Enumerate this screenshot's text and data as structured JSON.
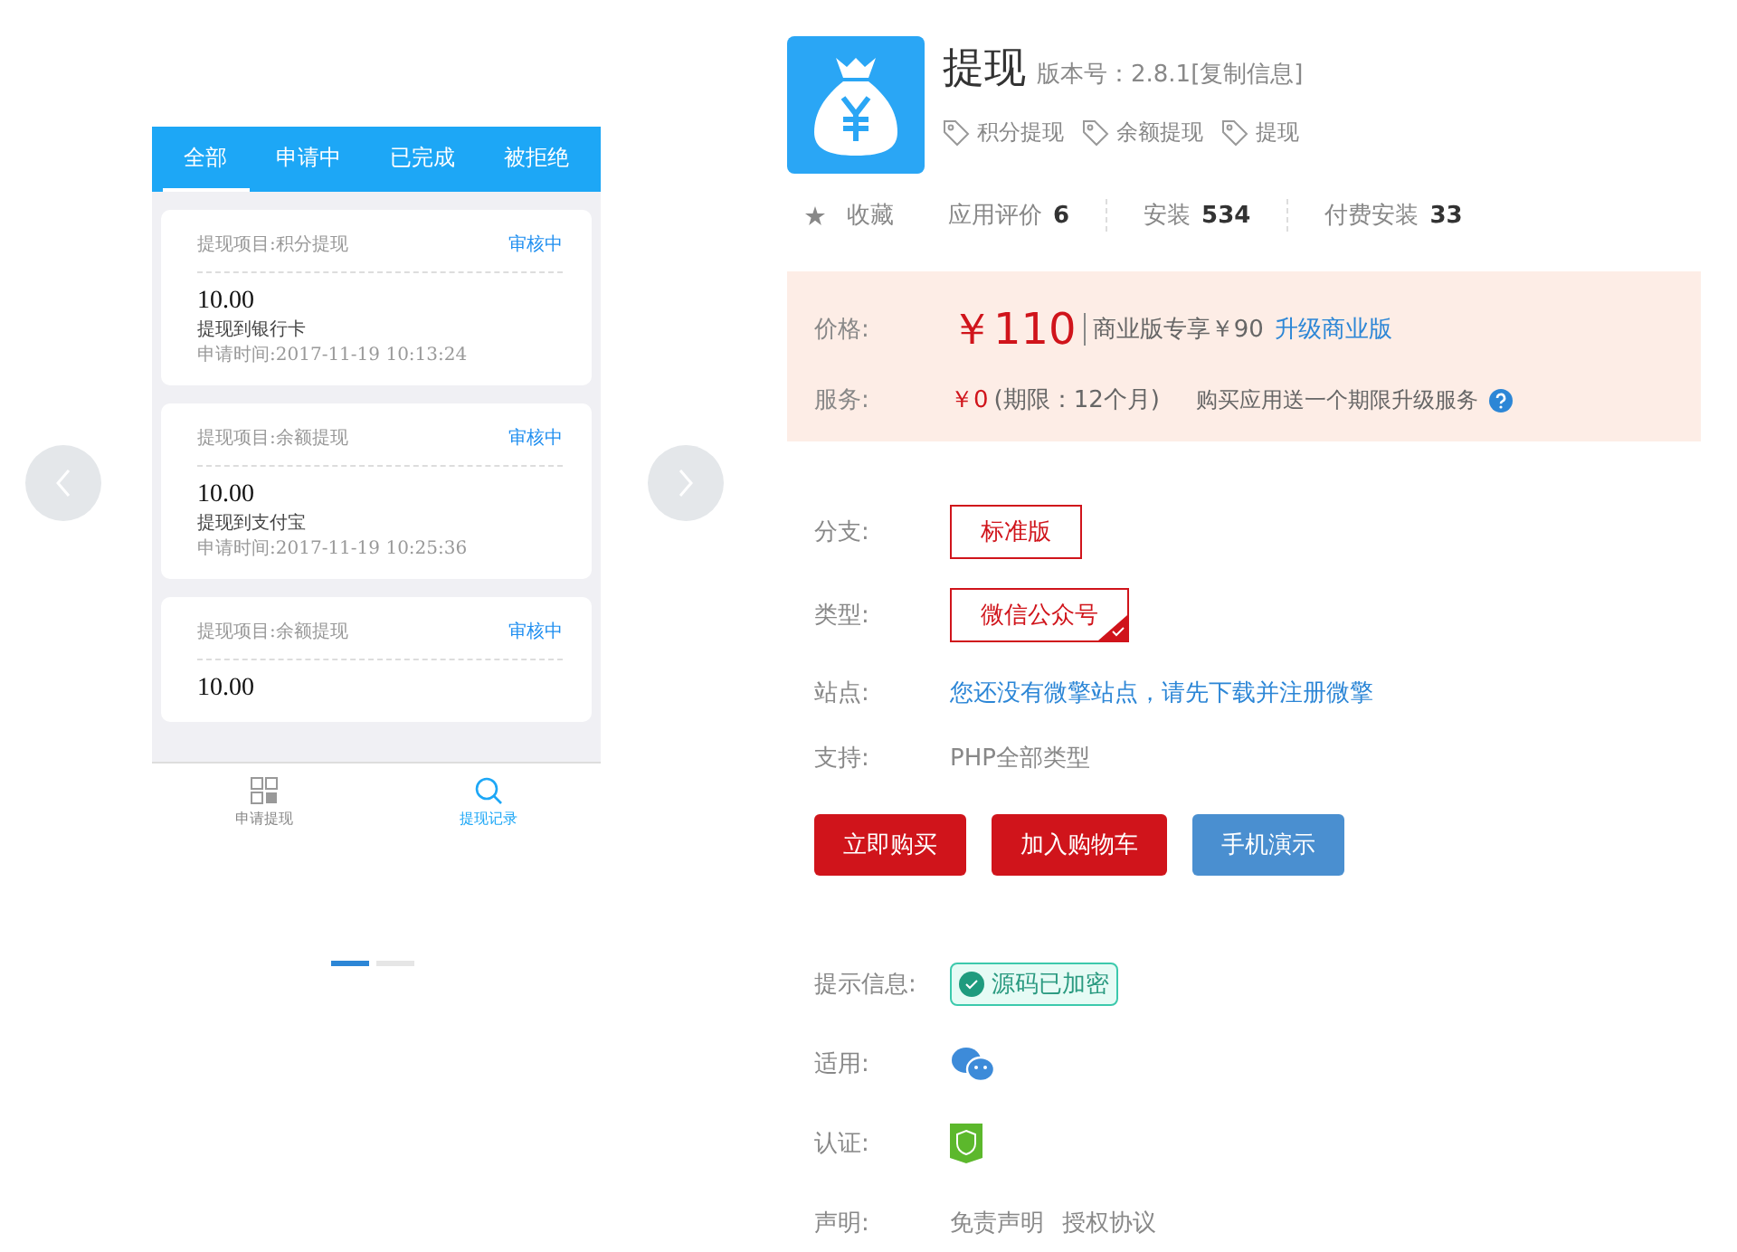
{
  "preview": {
    "tabs": [
      {
        "label": "全部",
        "selected": true
      },
      {
        "label": "申请中",
        "selected": false
      },
      {
        "label": "已完成",
        "selected": false
      },
      {
        "label": "被拒绝",
        "selected": false
      }
    ],
    "records": [
      {
        "item": "提现项目:积分提现",
        "status": "审核中",
        "amount": "10.00",
        "method": "提现到银行卡",
        "time": "申请时间:2017-11-19 10:13:24"
      },
      {
        "item": "提现项目:余额提现",
        "status": "审核中",
        "amount": "10.00",
        "method": "提现到支付宝",
        "time": "申请时间:2017-11-19 10:25:36"
      },
      {
        "item": "提现项目:余额提现",
        "status": "审核中",
        "amount": "10.00"
      }
    ],
    "nav": [
      {
        "label": "申请提现",
        "kind": "grid",
        "selected": false
      },
      {
        "label": "提现记录",
        "kind": "search",
        "selected": true
      }
    ],
    "dots": [
      {
        "selected": true
      },
      {
        "selected": false
      }
    ]
  },
  "app": {
    "title": "提现",
    "version": "版本号：2.8.1[复制信息]",
    "tags": [
      "积分提现",
      "余额提现",
      "提现"
    ],
    "favorite": "收藏",
    "stats": [
      {
        "label": "应用评价",
        "value": "6"
      },
      {
        "label": "安装",
        "value": "534"
      },
      {
        "label": "付费安装",
        "value": "33"
      }
    ]
  },
  "pricing": {
    "price_label": "价格:",
    "price": "￥110",
    "business": "商业版专享￥90",
    "upgrade": "升级商业版",
    "service_label": "服务:",
    "service_price": "￥0",
    "service_term": "(期限：12个月)",
    "service_note": "购买应用送一个期限升级服务"
  },
  "options": [
    {
      "label": "分支:",
      "choice": {
        "label": "标准版"
      }
    },
    {
      "label": "类型:",
      "choice": {
        "label": "微信公众号",
        "selected": true
      }
    }
  ],
  "site": {
    "label": "站点:",
    "text": "您还没有微擎站点，请先下载并注册微擎"
  },
  "support": {
    "label": "支持:",
    "text": "PHP全部类型"
  },
  "buttons": [
    {
      "label": "立即购买",
      "kind": "primary"
    },
    {
      "label": "加入购物车",
      "kind": "primary"
    },
    {
      "label": "手机演示",
      "kind": "secondary"
    }
  ],
  "info": [
    {
      "label": "提示信息:",
      "kind": "badge",
      "text": "源码已加密"
    },
    {
      "label": "适用:",
      "kind": "wechat"
    },
    {
      "label": "认证:",
      "kind": "cert"
    },
    {
      "label": "声明:",
      "kind": "links",
      "links": [
        "免责声明",
        "授权协议"
      ]
    }
  ]
}
